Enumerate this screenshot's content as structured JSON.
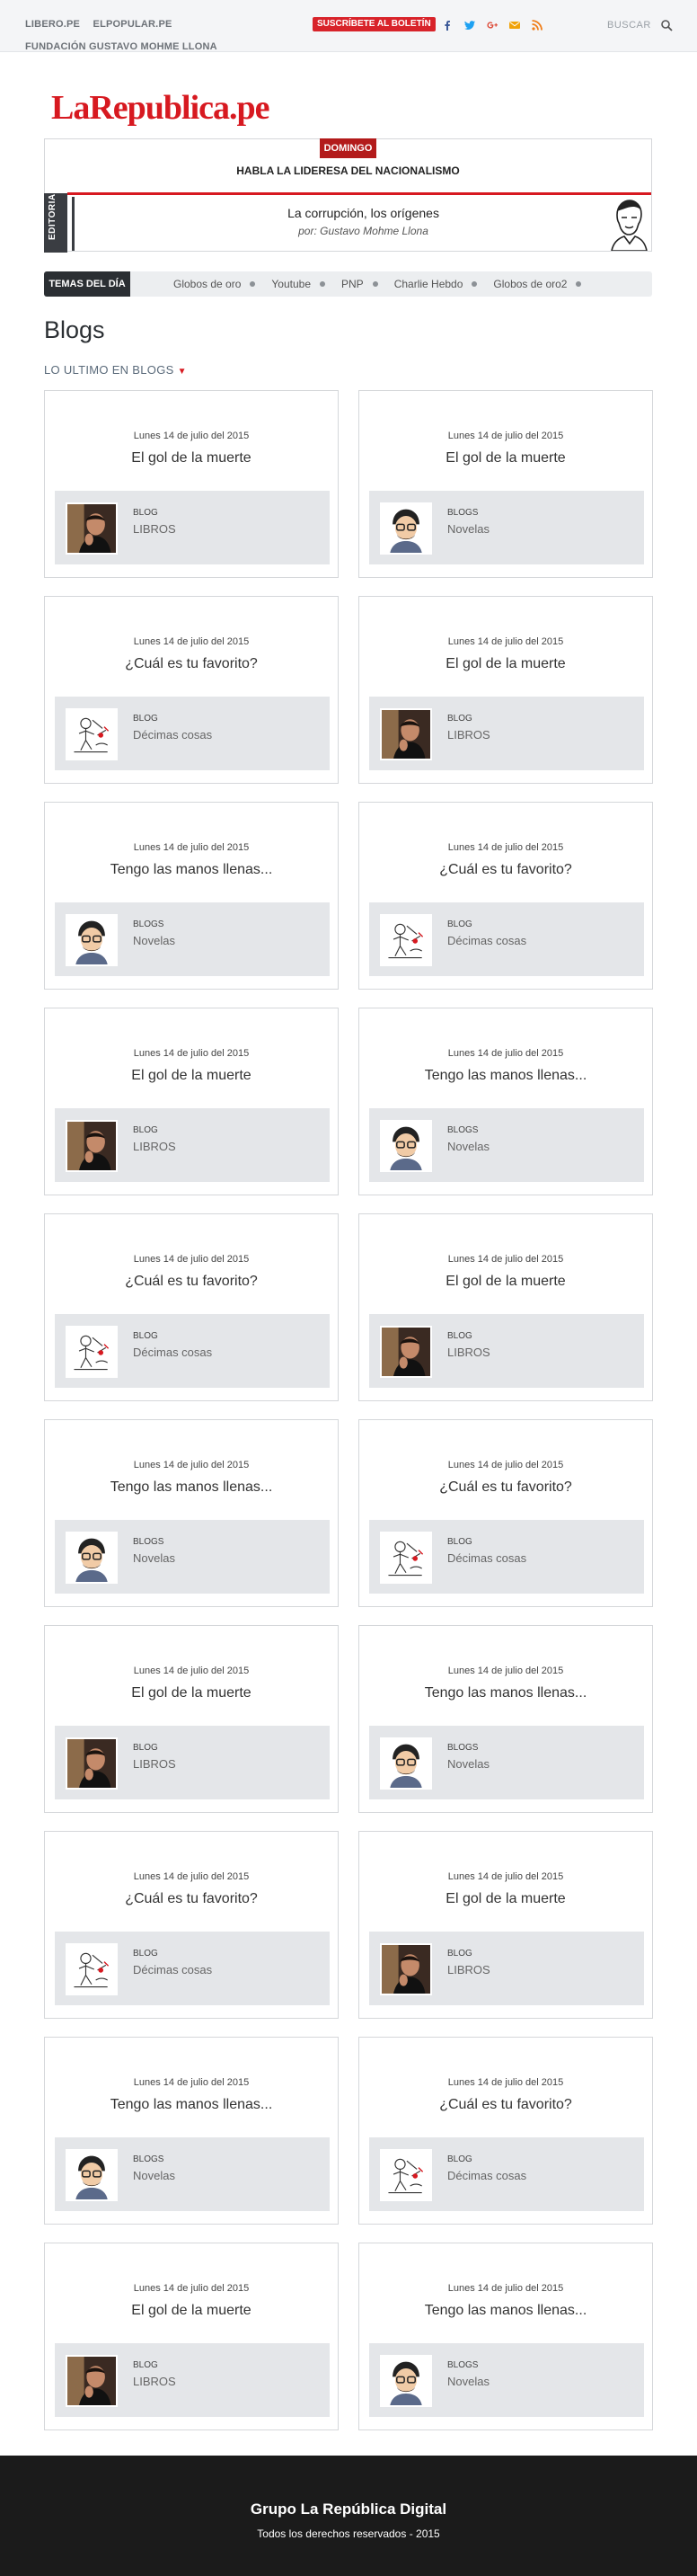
{
  "topbar": {
    "links": [
      "LIBERO.PE",
      "ELPOPULAR.PE",
      "FUNDACIÓN GUSTAVO MOHME LLONA"
    ],
    "subscribe_label": "SUSCRÍBETE AL BOLETÍN",
    "social_icons": [
      "facebook-icon",
      "twitter-icon",
      "google-plus-icon",
      "mail-icon",
      "rss-icon"
    ],
    "social_colors": [
      "#3b5998",
      "#1da1f2",
      "#dd4b39",
      "#f0a30a",
      "#f07d18"
    ],
    "search_label": "BUSCAR"
  },
  "logo": {
    "text": "LaRepublica.pe",
    "color": "#d71920"
  },
  "editorial": {
    "badge": "DOMINGO",
    "headline": "HABLA LA LIDERESA DEL NACIONALISMO",
    "sidebar_label": "EDITORIAL",
    "title": "La corrupción, los orígenes",
    "author": "por: Gustavo Mohme Llona"
  },
  "topics": {
    "label": "TEMAS DEL DÍA",
    "items": [
      "Globos de oro",
      "Youtube",
      "PNP",
      "Charlie Hebdo",
      "Globos de oro2"
    ]
  },
  "section": {
    "title": "Blogs",
    "subtitle": "LO ULTIMO EN BLOGS"
  },
  "cards": [
    {
      "date": "Lunes 14 de julio del 2015",
      "title": "El gol de la muerte",
      "category": "BLOG",
      "subcategory": "LIBROS",
      "avatar": "photo-man-icon"
    },
    {
      "date": "Lunes 14 de julio del 2015",
      "title": "El gol de la muerte",
      "category": "BLOGS",
      "subcategory": "Novelas",
      "avatar": "cartoon-man-icon"
    },
    {
      "date": "Lunes 14 de julio del 2015",
      "title": "¿Cuál es tu favorito?",
      "category": "BLOG",
      "subcategory": "Décimas cosas",
      "avatar": "sketch-icon"
    },
    {
      "date": "Lunes 14 de julio del 2015",
      "title": "El gol de la muerte",
      "category": "BLOG",
      "subcategory": "LIBROS",
      "avatar": "photo-man-icon"
    },
    {
      "date": "Lunes 14 de julio del 2015",
      "title": "Tengo las manos llenas...",
      "category": "BLOGS",
      "subcategory": "Novelas",
      "avatar": "cartoon-man-icon"
    },
    {
      "date": "Lunes 14 de julio del 2015",
      "title": "¿Cuál es tu favorito?",
      "category": "BLOG",
      "subcategory": "Décimas cosas",
      "avatar": "sketch-icon"
    },
    {
      "date": "Lunes 14 de julio del 2015",
      "title": "El gol de la muerte",
      "category": "BLOG",
      "subcategory": "LIBROS",
      "avatar": "photo-man-icon"
    },
    {
      "date": "Lunes 14 de julio del 2015",
      "title": "Tengo las manos llenas...",
      "category": "BLOGS",
      "subcategory": "Novelas",
      "avatar": "cartoon-man-icon"
    },
    {
      "date": "Lunes 14 de julio del 2015",
      "title": "¿Cuál es tu favorito?",
      "category": "BLOG",
      "subcategory": "Décimas cosas",
      "avatar": "sketch-icon"
    },
    {
      "date": "Lunes 14 de julio del 2015",
      "title": "El gol de la muerte",
      "category": "BLOG",
      "subcategory": "LIBROS",
      "avatar": "photo-man-icon"
    },
    {
      "date": "Lunes 14 de julio del 2015",
      "title": "Tengo las manos llenas...",
      "category": "BLOGS",
      "subcategory": "Novelas",
      "avatar": "cartoon-man-icon"
    },
    {
      "date": "Lunes 14 de julio del 2015",
      "title": "¿Cuál es tu favorito?",
      "category": "BLOG",
      "subcategory": "Décimas cosas",
      "avatar": "sketch-icon"
    },
    {
      "date": "Lunes 14 de julio del 2015",
      "title": "El gol de la muerte",
      "category": "BLOG",
      "subcategory": "LIBROS",
      "avatar": "photo-man-icon"
    },
    {
      "date": "Lunes 14 de julio del 2015",
      "title": "Tengo las manos llenas...",
      "category": "BLOGS",
      "subcategory": "Novelas",
      "avatar": "cartoon-man-icon"
    },
    {
      "date": "Lunes 14 de julio del 2015",
      "title": "¿Cuál es tu favorito?",
      "category": "BLOG",
      "subcategory": "Décimas cosas",
      "avatar": "sketch-icon"
    },
    {
      "date": "Lunes 14 de julio del 2015",
      "title": "El gol de la muerte",
      "category": "BLOG",
      "subcategory": "LIBROS",
      "avatar": "photo-man-icon"
    },
    {
      "date": "Lunes 14 de julio del 2015",
      "title": "Tengo las manos llenas...",
      "category": "BLOGS",
      "subcategory": "Novelas",
      "avatar": "cartoon-man-icon"
    },
    {
      "date": "Lunes 14 de julio del 2015",
      "title": "¿Cuál es tu favorito?",
      "category": "BLOG",
      "subcategory": "Décimas cosas",
      "avatar": "sketch-icon"
    },
    {
      "date": "Lunes 14 de julio del 2015",
      "title": "El gol de la muerte",
      "category": "BLOG",
      "subcategory": "LIBROS",
      "avatar": "photo-man-icon"
    },
    {
      "date": "Lunes 14 de julio del 2015",
      "title": "Tengo las manos llenas...",
      "category": "BLOGS",
      "subcategory": "Novelas",
      "avatar": "cartoon-man-icon"
    }
  ],
  "footer": {
    "title": "Grupo La República Digital",
    "text": "Todos los derechos reservados - 2015"
  }
}
